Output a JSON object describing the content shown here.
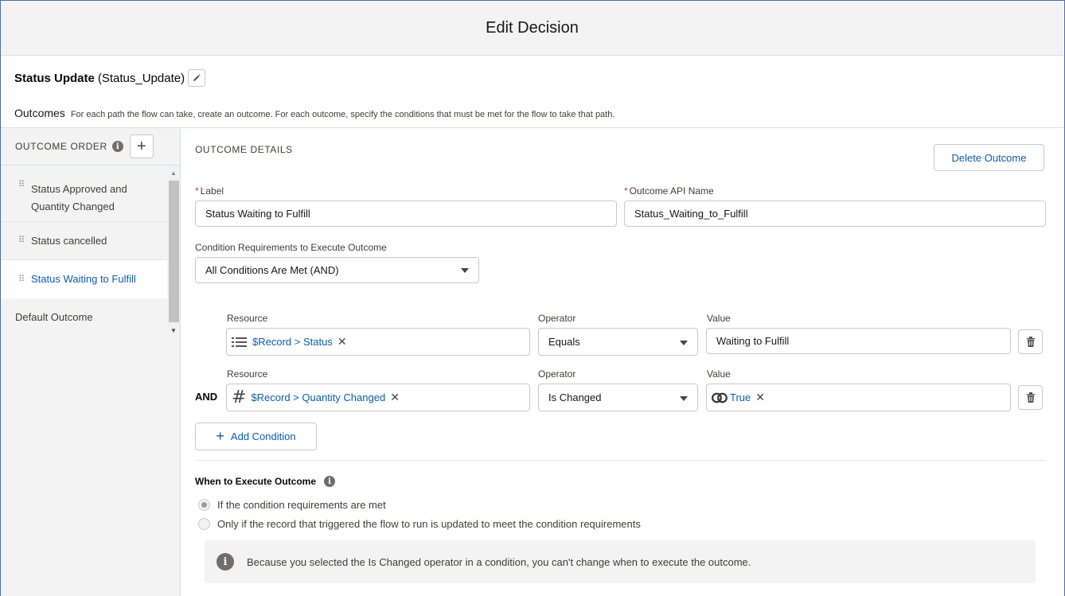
{
  "header": {
    "title": "Edit Decision"
  },
  "decision": {
    "label": "Status Update",
    "api_name": "(Status_Update)"
  },
  "outcomes": {
    "heading": "Outcomes",
    "description": "For each path the flow can take, create an outcome. For each outcome, specify the conditions that must be met for the flow to take that path."
  },
  "sidebar": {
    "title": "OUTCOME ORDER",
    "items": [
      {
        "label": "Status Approved and Quantity Changed"
      },
      {
        "label": "Status cancelled"
      },
      {
        "label": "Status Waiting to Fulfill"
      },
      {
        "label": "Default Outcome"
      }
    ]
  },
  "details": {
    "title": "OUTCOME DETAILS",
    "delete_label": "Delete Outcome",
    "label_field": {
      "label": "Label",
      "value": "Status Waiting to Fulfill"
    },
    "api_field": {
      "label": "Outcome API Name",
      "value": "Status_Waiting_to_Fulfill"
    },
    "requirements": {
      "label": "Condition Requirements to Execute Outcome",
      "value": "All Conditions Are Met (AND)"
    },
    "conditions": [
      {
        "resource_label": "Resource",
        "resource": "$Record > Status",
        "operator_label": "Operator",
        "operator": "Equals",
        "value_label": "Value",
        "value": "Waiting to Fulfill"
      },
      {
        "connector": "AND",
        "resource_label": "Resource",
        "resource": "$Record > Quantity Changed",
        "operator_label": "Operator",
        "operator": "Is Changed",
        "value_label": "Value",
        "value": "True"
      }
    ],
    "add_condition": "Add Condition",
    "when": {
      "title": "When to Execute Outcome",
      "option1": "If the condition requirements are met",
      "option2": "Only if the record that triggered the flow to run is updated to meet the condition requirements",
      "notice": "Because you selected the Is Changed operator in a condition, you can't change when to execute the outcome."
    }
  },
  "colors": {
    "link": "#0b5cab",
    "required": "#c23934",
    "frame": "#4a6fa5"
  }
}
